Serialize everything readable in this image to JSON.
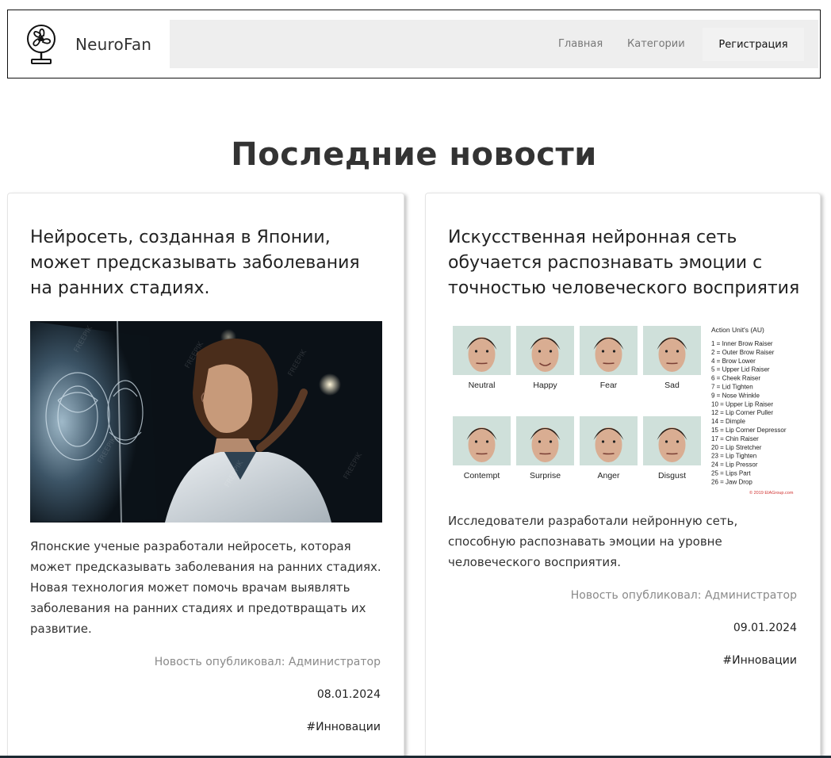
{
  "header": {
    "brand": "NeuroFan",
    "logo_icon": "fan-icon",
    "nav": {
      "home": "Главная",
      "categories": "Категории",
      "register": "Регистрация"
    }
  },
  "main": {
    "title": "Последние новости",
    "cards": [
      {
        "title": "Нейросеть, созданная в Японии, может предсказывать заболевания на ранних стадиях.",
        "image": "doctor-with-brain-scan-image",
        "text": "Японские ученые разработали нейросеть, которая может предсказывать заболевания на ранних стадиях. Новая технология может помочь врачам выявлять заболевания на ранних стадиях и предотвращать их развитие.",
        "author": "Новость опубликовал: Администратор",
        "date": "08.01.2024",
        "tag": "#Инновации"
      },
      {
        "title": "Искусственная нейронная сеть обучается распознавать эмоции с точностью человеческого восприятия",
        "image": "facial-emotions-chart-image",
        "text": "Исследователи разработали нейронную сеть, способную распознавать эмоции на уровне человеческого восприятия.",
        "author": "Новость опубликовал: Администратор",
        "date": "09.01.2024",
        "tag": "#Инновации",
        "emotions_figure": {
          "faces": [
            "Neutral",
            "Happy",
            "Fear",
            "Sad",
            "Contempt",
            "Surprise",
            "Anger",
            "Disgust"
          ],
          "au_title": "Action Unit's (AU)",
          "au_list": [
            "1 = Inner Brow Raiser",
            "2 = Outer Brow Raiser",
            "4 = Brow Lower",
            "5 = Upper Lid Raiser",
            "6 = Cheek Raiser",
            "7 = Lid Tighten",
            "9 = Nose Wrinkle",
            "10 = Upper Lip Raiser",
            "12 = Lip Corner Puller",
            "14 = Dimple",
            "15 = Lip Corner Depressor",
            "17 = Chin Raiser",
            "20 = Lip Stretcher",
            "23 = Lip Tighten",
            "24 = Lip Pressor",
            "25 = Lips Part",
            "26 = Jaw Drop"
          ],
          "copyright": "© 2019 EIAGroup.com"
        }
      }
    ]
  }
}
